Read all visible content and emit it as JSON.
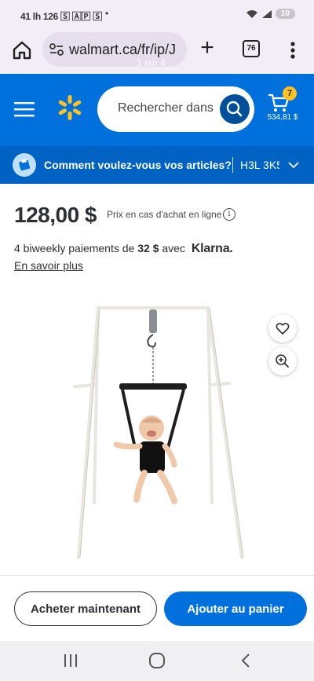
{
  "status_bar": {
    "left_text": "41 lh 126 🅂 🄰🄿 🅂",
    "dot": "•",
    "battery": "10"
  },
  "browser": {
    "url": "walmart.ca/fr/ip/J",
    "url_overlay": "1 sur 4",
    "tab_count": "76"
  },
  "header": {
    "search_placeholder": "Rechercher dans",
    "cart_count": "7",
    "cart_total": "534,81 $",
    "brand_color": "#0071dc",
    "spark_color": "#ffc220"
  },
  "delivery": {
    "question": "Comment voulez-vous vos articles?",
    "postal_code": "H3L 3K5"
  },
  "product": {
    "price": "128,00 $",
    "price_note": "Prix en cas d'achat en ligne",
    "klarna_prefix": "4 biweekly paiements de",
    "klarna_amount": "32 $",
    "klarna_with": "avec",
    "klarna_brand": "Klarna.",
    "learn_more": "En savoir plus"
  },
  "actions": {
    "buy_now": "Acheter maintenant",
    "add_to_cart": "Ajouter au panier"
  }
}
